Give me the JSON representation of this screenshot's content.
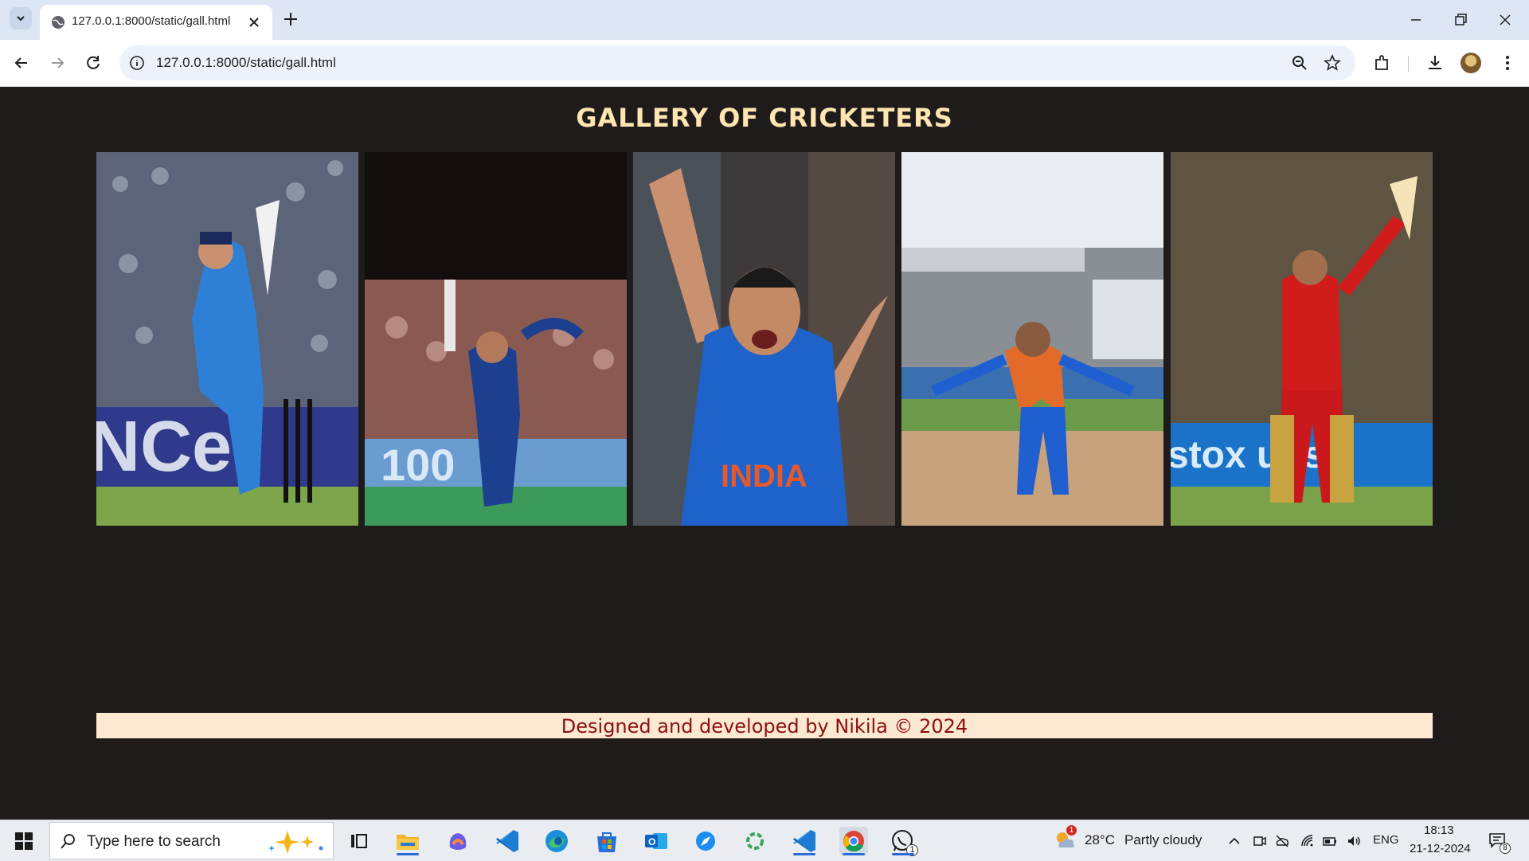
{
  "browser": {
    "tab_title": "127.0.0.1:8000/static/gall.html",
    "url": "127.0.0.1:8000/static/gall.html"
  },
  "page": {
    "title": "GALLERY OF CRICKETERS",
    "photos": [
      {
        "name": "cricketer-photo-1"
      },
      {
        "name": "cricketer-photo-2"
      },
      {
        "name": "cricketer-photo-3"
      },
      {
        "name": "cricketer-photo-4"
      },
      {
        "name": "cricketer-photo-5"
      }
    ],
    "footer": "Designed and developed by Nikila © 2024"
  },
  "taskbar": {
    "search_placeholder": "Type here to search",
    "weather_temp": "28°C",
    "weather_desc": "Partly cloudy",
    "weather_badge": "1",
    "language": "ENG",
    "time": "18:13",
    "date": "21-12-2024",
    "notifications_count": "8",
    "whatsapp_badge": "1"
  },
  "colors": {
    "page_bg": "#201b1b",
    "title": "#ffe5b0",
    "footer_bg": "#fde8d2",
    "footer_text": "#8b0f0f"
  }
}
